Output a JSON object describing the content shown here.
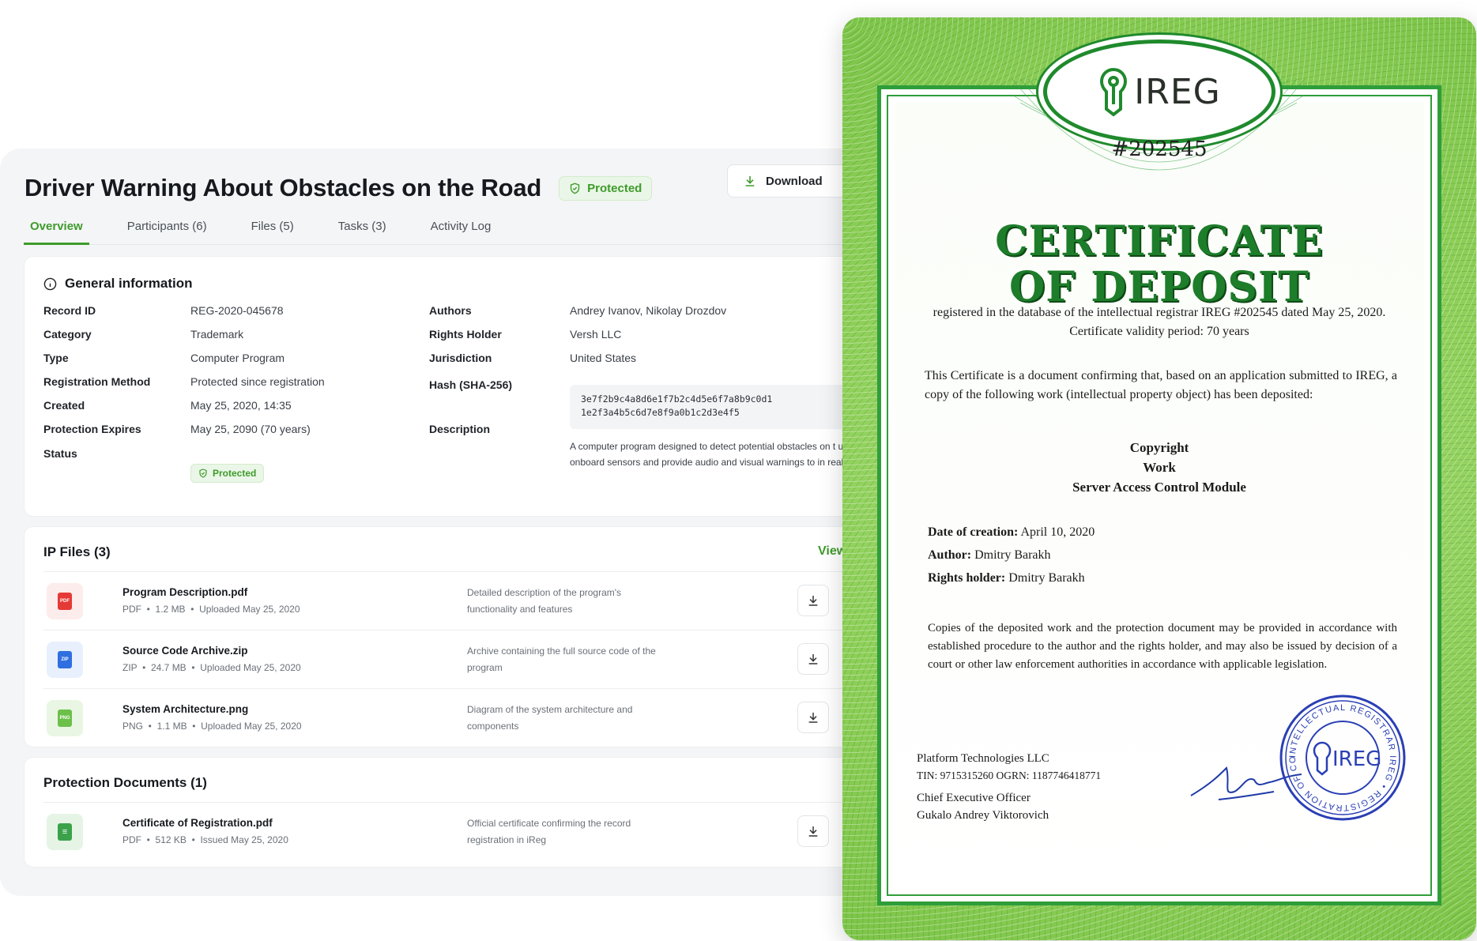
{
  "record": {
    "title": "Driver Warning About Obstacles on the Road",
    "badge": "Protected",
    "download_label": "Download"
  },
  "tabs": [
    "Overview",
    "Participants (6)",
    "Files (5)",
    "Tasks (3)",
    "Activity Log"
  ],
  "general": {
    "title": "General information",
    "left": [
      {
        "label": "Record ID",
        "value": "REG-2020-045678"
      },
      {
        "label": "Category",
        "value": "Trademark"
      },
      {
        "label": "Type",
        "value": "Computer Program"
      },
      {
        "label": "Registration Method",
        "value": "Protected since registration"
      },
      {
        "label": "Created",
        "value": "May 25, 2020, 14:35"
      },
      {
        "label": "Protection Expires",
        "value": "May 25, 2090 (70 years)"
      },
      {
        "label": "Status",
        "value": "Protected"
      }
    ],
    "right": [
      {
        "label": "Authors",
        "value": "Andrey Ivanov, Nikolay Drozdov"
      },
      {
        "label": "Rights Holder",
        "value": "Versh LLC"
      },
      {
        "label": "Jurisdiction",
        "value": "United States"
      },
      {
        "label": "Hash (SHA-256)",
        "value": ""
      },
      {
        "label": "Description",
        "value": ""
      }
    ],
    "hash_line1": "3e7f2b9c4a8d6e1f7b2c4d5e6f7a8b9c0d1",
    "hash_line2": "1e2f3a4b5c6d7e8f9a0b1c2d3e4f5",
    "description": "A computer program designed to detect potential obstacles on t using onboard sensors and provide audio and visual warnings to in real time."
  },
  "ip_files": {
    "title": "IP Files (3)",
    "view_all": "View",
    "items": [
      {
        "name": "Program Description.pdf",
        "type": "PDF",
        "size": "1.2 MB",
        "date": "Uploaded May 25, 2020",
        "desc": "Detailed description of the program's functionality and features",
        "icon_color": "#e53935",
        "icon_bg": "#fdecec",
        "icon_text": "PDF"
      },
      {
        "name": "Source Code Archive.zip",
        "type": "ZIP",
        "size": "24.7 MB",
        "date": "Uploaded May 25, 2020",
        "desc": "Archive containing the full source code of the program",
        "icon_color": "#2f6fe0",
        "icon_bg": "#e8f0fd",
        "icon_text": "ZIP"
      },
      {
        "name": "System Architecture.png",
        "type": "PNG",
        "size": "1.1 MB",
        "date": "Uploaded May 25, 2020",
        "desc": "Diagram of the system architecture and components",
        "icon_color": "#6cc04a",
        "icon_bg": "#eaf6e4",
        "icon_text": "PNG"
      }
    ]
  },
  "protection_docs": {
    "title": "Protection Documents (1)",
    "items": [
      {
        "name": "Certificate of Registration.pdf",
        "type": "PDF",
        "size": "512 KB",
        "date": "Issued May 25, 2020",
        "desc": "Official certificate confirming the record registration in iReg",
        "icon_color": "#3ba24a",
        "icon_bg": "#e6f4e6",
        "icon_text": "≡"
      }
    ]
  },
  "certificate": {
    "logo": "IREG",
    "number": "#202545",
    "title_line1": "CERTIFICATE",
    "title_line2": "OF DEPOSIT",
    "subtitle": "registered in the database of the intellectual registrar IREG #202545 dated May 25, 2020. Certificate validity period: 70 years",
    "paragraph1": "This Certificate is a document confirming that, based on an application submitted to IREG, a copy of the following work (intellectual property object) has been deposited:",
    "work_line1": "Copyright",
    "work_line2": "Work",
    "work_line3": "Server Access Control Module",
    "date_label": "Date of creation:",
    "date_value": "April 10, 2020",
    "author_label": "Author:",
    "author_value": "Dmitry Barakh",
    "holder_label": "Rights holder:",
    "holder_value": "Dmitry Barakh",
    "paragraph2": "Copies of the deposited work and the protection document may be provided in accordance with established procedure to the author and the rights holder, and may also be issued by decision of a court or other law enforcement authorities in accordance with applicable legislation.",
    "company": "Platform Technologies LLC",
    "company_ids": "TIN: 9715315260 OGRN: 1187746418771",
    "signer_role": "Chief Executive Officer",
    "signer_name": "Gukalo Andrey Viktorovich",
    "seal_ring_text": "INTELLECTUAL REGISTRAR IREG • REGISTRATION OF COPYRIGHTS •",
    "seal_logo": "IREG"
  }
}
